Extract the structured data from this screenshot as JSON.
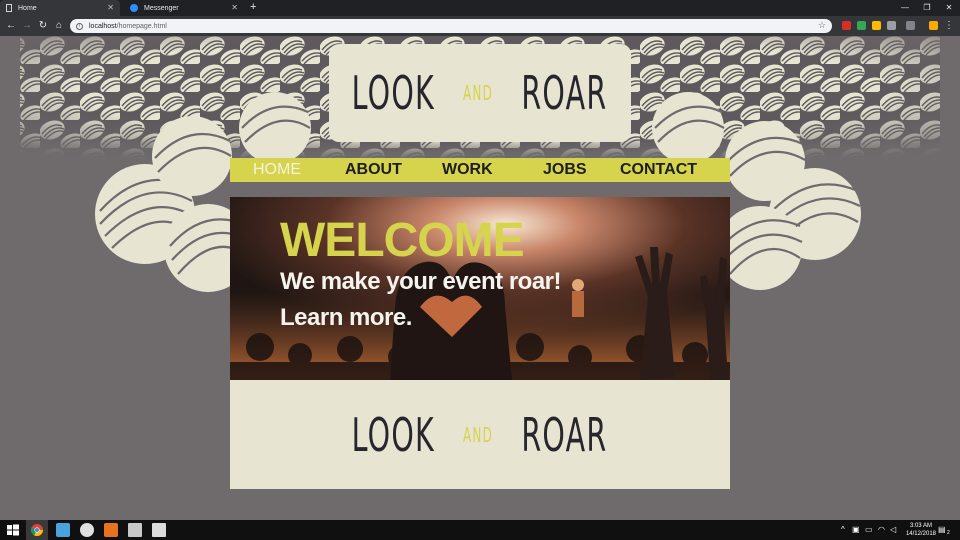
{
  "browser": {
    "tabs": [
      {
        "title": "Home",
        "active": true
      },
      {
        "title": "Messenger",
        "active": false
      }
    ],
    "new_tab": "+",
    "address": "localhost/homepage.html",
    "address_host": "localhost",
    "address_path": "/homepage.html"
  },
  "site": {
    "logo": {
      "look": "LOOK",
      "and": "AND",
      "roar": "ROAR"
    },
    "nav": [
      "HOME",
      "ABOUT",
      "WORK",
      "JOBS",
      "CONTACT"
    ],
    "active_nav": "HOME",
    "hero": {
      "welcome": "WELCOME",
      "tagline": "We make your event roar!",
      "cta": "Learn more."
    },
    "footer_logo": {
      "look": "LOOK",
      "and": "AND",
      "roar": "ROAR"
    },
    "colors": {
      "accent": "#d6d34c",
      "cream": "#e8e4d2",
      "background": "#6f6b6d",
      "dark": "#27262d"
    }
  },
  "taskbar": {
    "time": "3:03 AM",
    "date": "14/12/2018",
    "notifications": "2"
  }
}
